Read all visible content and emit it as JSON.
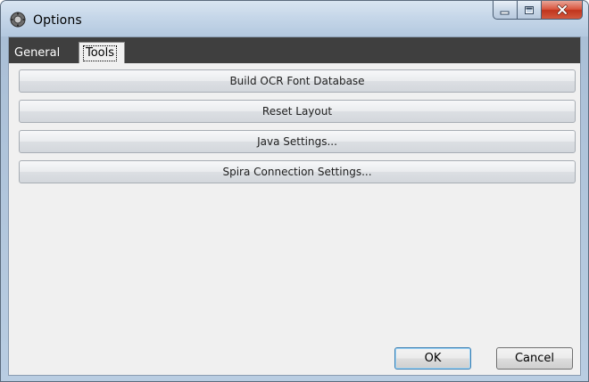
{
  "window": {
    "title": "Options",
    "icon": "options-app-icon",
    "caption_buttons": {
      "minimize": "minimize-icon",
      "maximize": "maximize-icon",
      "close": "close-icon"
    }
  },
  "tabs": [
    {
      "label": "General",
      "selected": false
    },
    {
      "label": "Tools",
      "selected": true
    }
  ],
  "tools": {
    "buttons": [
      {
        "label": "Build OCR Font Database"
      },
      {
        "label": "Reset Layout"
      },
      {
        "label": "Java Settings..."
      },
      {
        "label": "Spira Connection Settings..."
      }
    ]
  },
  "footer": {
    "ok_label": "OK",
    "cancel_label": "Cancel"
  },
  "colors": {
    "close_button": "#c7432a",
    "tabstrip_background": "#3f3f3f",
    "client_background": "#f0f0f0"
  }
}
